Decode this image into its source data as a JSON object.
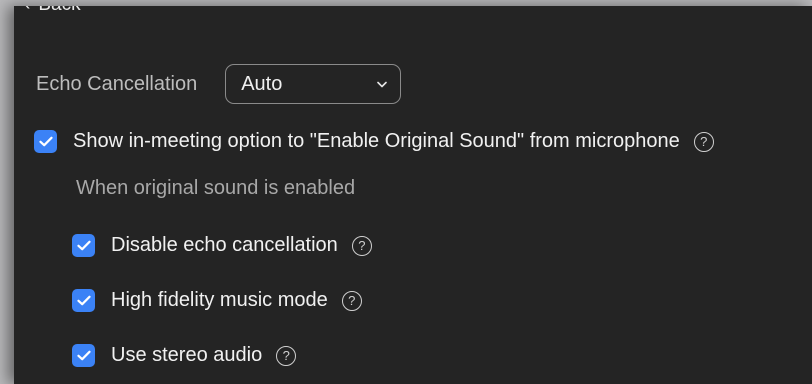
{
  "nav": {
    "back_label": "Back"
  },
  "echo": {
    "label": "Echo Cancellation",
    "selected": "Auto"
  },
  "original_sound": {
    "label": "Show in-meeting option to \"Enable Original Sound\" from microphone",
    "checked": true,
    "sub_heading": "When original sound is enabled",
    "options": [
      {
        "label": "Disable echo cancellation",
        "checked": true
      },
      {
        "label": "High fidelity music mode",
        "checked": true
      },
      {
        "label": "Use stereo audio",
        "checked": true
      }
    ]
  },
  "colors": {
    "accent": "#3b82f6",
    "panel_bg": "#242424",
    "text": "#f1f1f1",
    "muted_text": "#a8a8a8"
  }
}
